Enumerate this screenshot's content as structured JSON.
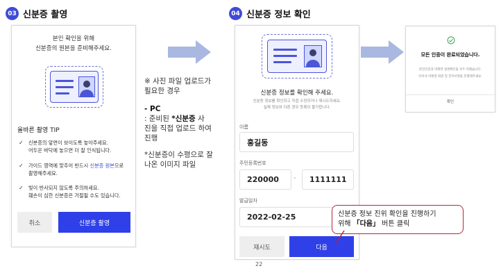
{
  "step3": {
    "num": "03",
    "title": "신분증 촬영",
    "intro_line1": "본인 확인을 위해",
    "intro_line2": "신분증의 원본을 준비해주세요.",
    "tip_title": "올바른 촬영 TIP",
    "tips": [
      {
        "line1": "신분증의 앞면이 보이도록 놓아주세요.",
        "line2": "어두운 바닥에 놓으면 더 잘 인식됩니다."
      },
      {
        "line1_pre": "가이드 영역에 맞추어 반드시 ",
        "line1_hl": "신분증 원본",
        "line1_post": "으로",
        "line2": "촬영해주세요."
      },
      {
        "line1": "빛이 반사되지 않도록 주의하세요.",
        "line2": "훼손이 심한 신분증은 거절될 수도 있습니다."
      }
    ],
    "cancel_label": "취소",
    "capture_label": "신분증 촬영"
  },
  "note": {
    "line1": "※ 사진 파일 업로드가",
    "line2": "필요한 경우",
    "pc_title": "- PC",
    "pc_line1_pre": "  : 준비된 ",
    "pc_line1_hl": "*신분증",
    "pc_line1_post": " 사",
    "pc_line2": "진을 직접 업로드 하여",
    "pc_line3": "진행",
    "foot_line1": "*신분증이 수평으로 잘",
    "foot_line2": "나온 이미지 파일"
  },
  "step4": {
    "num": "04",
    "title": "신분증 정보 확인",
    "heading": "신분증 정보를 확인해 주세요.",
    "sub1": "신분증 정보를 확인하고 직접 수정하거나 재시도하세요.",
    "sub2": "실제 정보와 다른 경우 등록이 불가합니다.",
    "name_label": "이름",
    "name_value": "홍길동",
    "rrn_label": "주민등록번호",
    "rrn_front": "220000",
    "rrn_dash": "-",
    "rrn_back": "1111111",
    "issue_label": "발급일자",
    "issue_value": "2022-02-25",
    "retry_label": "재시도",
    "next_label": "다음"
  },
  "callout": {
    "line1": "신분증 정보 진위 확인을 진행하기",
    "line2_pre": "위해 ",
    "line2_hl": "「다음」",
    "line2_post": " 버튼 클릭"
  },
  "step5": {
    "title": "모든 인증이 완료되었습니다.",
    "sub1": "본인인증과 미래엔 실명확인을 모두 마쳤습니다.",
    "sub2": "이어서 미래엔 회원 및 전자서명을 진행해주세요.",
    "confirm_label": "확인"
  },
  "page_number": "22",
  "colors": {
    "accent": "#2f40e8",
    "arrow": "#a9b8e0",
    "callout_border": "#b3253a"
  }
}
